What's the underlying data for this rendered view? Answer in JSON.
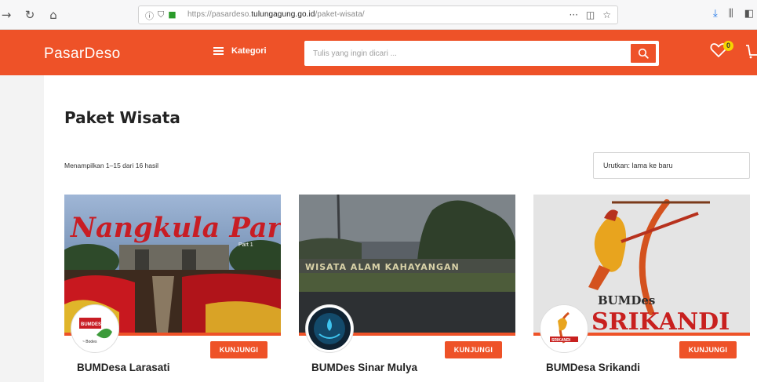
{
  "browser": {
    "url_prefix": "https://pasardeso.",
    "url_domain": "tulungagung.go.id",
    "url_path": "/paket-wisata/"
  },
  "header": {
    "logo": "PasarDeso",
    "category_label": "Kategori",
    "search_placeholder": "Tulis yang ingin dicari ...",
    "wishlist_count": "0",
    "accent_color": "#ee5228"
  },
  "page": {
    "title": "Paket Wisata",
    "results_text": "Menampilkan 1–15 dari 16 hasil",
    "sort_value": "Urutkan: lama ke baru"
  },
  "cards": [
    {
      "name": "BUMDesa Larasati",
      "button": "KUNJUNGI",
      "banner_text": "Nangkula Park",
      "banner_sub": "Part 1",
      "logo_text": "BUMDES",
      "logo_tag": "~ Bodes"
    },
    {
      "name": "BUMDes Sinar Mulya",
      "button": "KUNJUNGI",
      "banner_text": "WISATA ALAM   KAHAYANGAN"
    },
    {
      "name": "BUMDesa Srikandi",
      "button": "KUNJUNGI",
      "banner_text": "BUMDes",
      "banner_sub": "SRIKANDI",
      "logo_text": "SRIKANDI"
    }
  ]
}
